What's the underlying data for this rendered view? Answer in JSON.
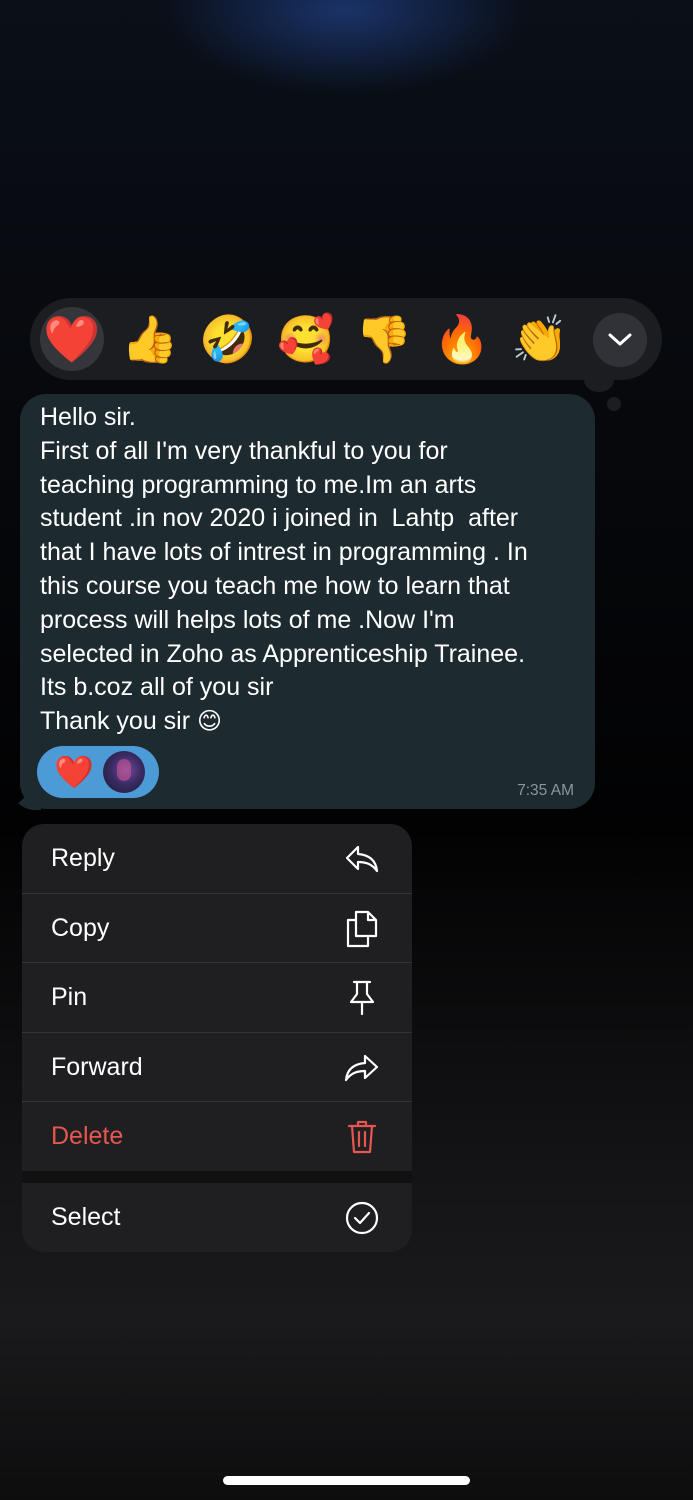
{
  "reactions": [
    {
      "emoji": "❤️",
      "name": "heart"
    },
    {
      "emoji": "👍",
      "name": "thumbs-up"
    },
    {
      "emoji": "🤣",
      "name": "rolling-laughing"
    },
    {
      "emoji": "🥰",
      "name": "smiling-hearts"
    },
    {
      "emoji": "👎",
      "name": "thumbs-down"
    },
    {
      "emoji": "🔥",
      "name": "fire"
    },
    {
      "emoji": "👏",
      "name": "clapping"
    }
  ],
  "more_reactions_icon": "chevron-down-icon",
  "message": {
    "lines": [
      "Hello sir.",
      "First of all I'm very thankful to you for",
      "teaching programming to me.Im an arts",
      "student .in nov 2020 i joined in  Lahtp  after",
      "that I have lots of intrest in programming . In",
      "this course you teach me how to learn that",
      "process will helps lots of me .Now I'm",
      "selected in Zoho as Apprenticeship Trainee.",
      "Its b.coz all of you sir",
      "Thank you sir"
    ],
    "closing_emoji": "😊",
    "reaction_emoji": "❤️",
    "time": "7:35 AM"
  },
  "menu": {
    "reply": "Reply",
    "copy": "Copy",
    "pin": "Pin",
    "forward": "Forward",
    "delete": "Delete",
    "select": "Select"
  },
  "colors": {
    "bubble": "#1d2a30",
    "menu_bg": "#1f1f21",
    "delete": "#e5574f",
    "reaction_pill": "#4d9bd6"
  }
}
